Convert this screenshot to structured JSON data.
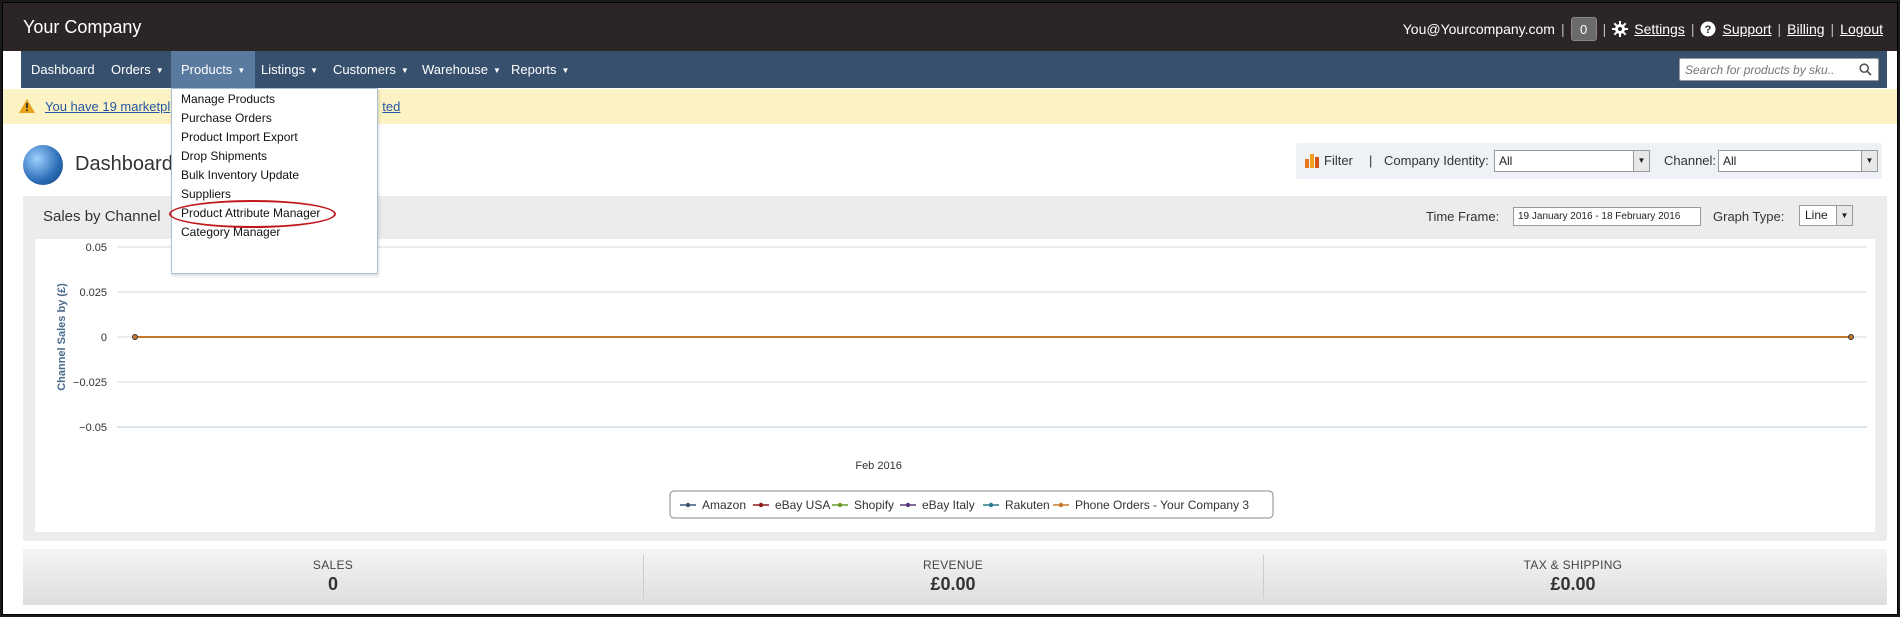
{
  "app": {
    "brand": "Your Company"
  },
  "topbar": {
    "email": "You@Yourcompany.com",
    "notification_count": "0",
    "settings_label": "Settings",
    "support_label": "Support",
    "billing_label": "Billing",
    "logout_label": "Logout",
    "separator": "|"
  },
  "nav": {
    "items": [
      {
        "label": "Dashboard"
      },
      {
        "label": "Orders"
      },
      {
        "label": "Products"
      },
      {
        "label": "Listings"
      },
      {
        "label": "Customers"
      },
      {
        "label": "Warehouse"
      },
      {
        "label": "Reports"
      }
    ],
    "search_placeholder": "Search for products by sku.."
  },
  "products_menu": {
    "items": [
      "Manage Products",
      "Purchase Orders",
      "Product Import Export",
      "Drop Shipments",
      "Bulk Inventory Update",
      "Suppliers",
      "Product Attribute Manager",
      "Category Manager"
    ],
    "highlighted": "Product Attribute Manager"
  },
  "alert": {
    "message_left": "You have 19 marketpl",
    "message_right": "ted"
  },
  "page": {
    "title": "Dashboard"
  },
  "filters": {
    "filter_label": "Filter",
    "separator": "|",
    "company_identity_label": "Company Identity:",
    "company_identity_value": "All",
    "channel_label": "Channel:",
    "channel_value": "All"
  },
  "sales_panel": {
    "title": "Sales by Channel",
    "time_frame_label": "Time Frame:",
    "time_frame_value": "19 January 2016 - 18 February 2016",
    "graph_type_label": "Graph Type:",
    "graph_type_value": "Line"
  },
  "chart_data": {
    "type": "line",
    "ylabel": "Channel Sales by (£)",
    "xlabel": "",
    "ylim": [
      -0.05,
      0.05
    ],
    "yticks": [
      "0.05",
      "0.025",
      "0",
      "−0.025",
      "−0.05"
    ],
    "ytick_values": [
      0.05,
      0.025,
      0,
      -0.025,
      -0.05
    ],
    "x_tick_label": "Feb 2016",
    "x": [
      "19 Jan 2016",
      "18 Feb 2016"
    ],
    "x_tick_position": "2016-02-01",
    "series": [
      {
        "name": "Amazon",
        "color": "#3d5a7a",
        "values": [
          0,
          0
        ]
      },
      {
        "name": "eBay USA",
        "color": "#8b1a1a",
        "values": [
          0,
          0
        ]
      },
      {
        "name": "Shopify",
        "color": "#6a9a2a",
        "values": [
          0,
          0
        ]
      },
      {
        "name": "eBay Italy",
        "color": "#5a3a7a",
        "values": [
          0,
          0
        ]
      },
      {
        "name": "Rakuten",
        "color": "#2a7a8a",
        "values": [
          0,
          0
        ]
      },
      {
        "name": "Phone Orders - Your Company 3",
        "color": "#c47a2a",
        "values": [
          0,
          0
        ]
      }
    ],
    "grid": true,
    "legend_position": "bottom-center"
  },
  "summary": {
    "sales_label": "SALES",
    "sales_value": "0",
    "revenue_label": "REVENUE",
    "revenue_value": "£0.00",
    "tax_label": "TAX & SHIPPING",
    "tax_value": "£0.00"
  }
}
